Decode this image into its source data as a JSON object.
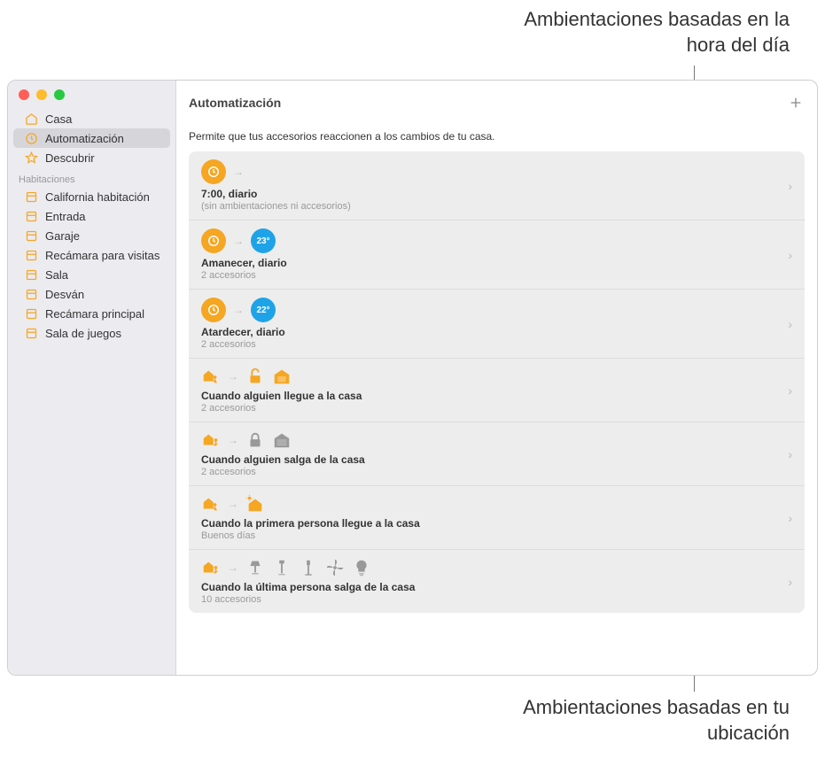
{
  "annotations": {
    "top": "Ambientaciones basadas en la hora del día",
    "bottom": "Ambientaciones basadas en tu ubicación"
  },
  "sidebar": {
    "primary": [
      {
        "label": "Casa",
        "icon": "home"
      },
      {
        "label": "Automatización",
        "icon": "automation",
        "active": true
      },
      {
        "label": "Descubrir",
        "icon": "star"
      }
    ],
    "section_label": "Habitaciones",
    "rooms": [
      {
        "label": "California habitación"
      },
      {
        "label": "Entrada"
      },
      {
        "label": "Garaje"
      },
      {
        "label": "Recámara para visitas"
      },
      {
        "label": "Sala"
      },
      {
        "label": "Desván"
      },
      {
        "label": "Recámara principal"
      },
      {
        "label": "Sala de juegos"
      }
    ]
  },
  "main": {
    "title": "Automatización",
    "subtitle": "Permite que tus accesorios reaccionen a los cambios de tu casa.",
    "automations": [
      {
        "type": "time",
        "title": "7:00, diario",
        "sub": "(sin ambientaciones ni accesorios)",
        "badge": null
      },
      {
        "type": "time",
        "title": "Amanecer, diario",
        "sub": "2 accesorios",
        "badge": "23°"
      },
      {
        "type": "time",
        "title": "Atardecer, diario",
        "sub": "2 accesorios",
        "badge": "22°"
      },
      {
        "type": "location-arrive",
        "title": "Cuando alguien llegue a la casa",
        "sub": "2 accesorios",
        "icons": [
          "person-home-arrive",
          "lock-open",
          "garage"
        ]
      },
      {
        "type": "location-leave",
        "title": "Cuando alguien salga de la casa",
        "sub": "2 accesorios",
        "icons": [
          "person-home-leave",
          "lock-closed",
          "garage-closed"
        ]
      },
      {
        "type": "location-first",
        "title": "Cuando la primera persona llegue a la casa",
        "sub": "Buenos días",
        "icons": [
          "person-home-arrive",
          "scene-home"
        ]
      },
      {
        "type": "location-last",
        "title": "Cuando la última persona salga de la casa",
        "sub": "10 accesorios",
        "icons": [
          "person-home-leave",
          "lamp1",
          "lamp2",
          "lamp3",
          "fan",
          "bulb"
        ]
      }
    ]
  }
}
